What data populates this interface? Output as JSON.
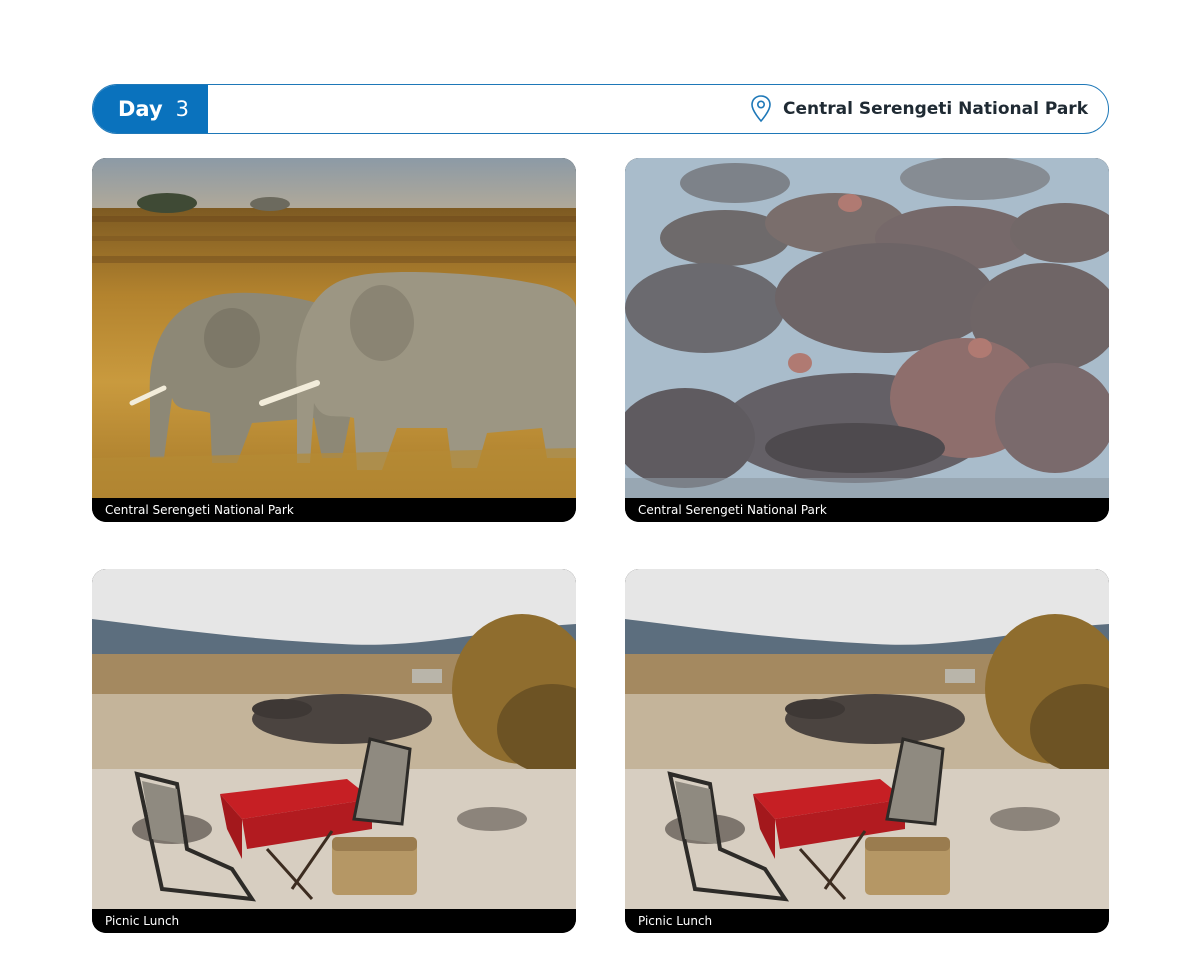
{
  "header": {
    "day_label": "Day",
    "day_number": "3",
    "location": "Central Serengeti National Park",
    "accent_color": "#0a72bd"
  },
  "cards": [
    {
      "caption": "Central Serengeti National Park",
      "scene": "elephants-grassland"
    },
    {
      "caption": "Central Serengeti National Park",
      "scene": "hippos-water"
    },
    {
      "caption": "Picnic Lunch",
      "scene": "picnic-setup"
    },
    {
      "caption": "Picnic Lunch",
      "scene": "picnic-setup"
    }
  ],
  "icons": {
    "location": "map-pin-icon"
  }
}
